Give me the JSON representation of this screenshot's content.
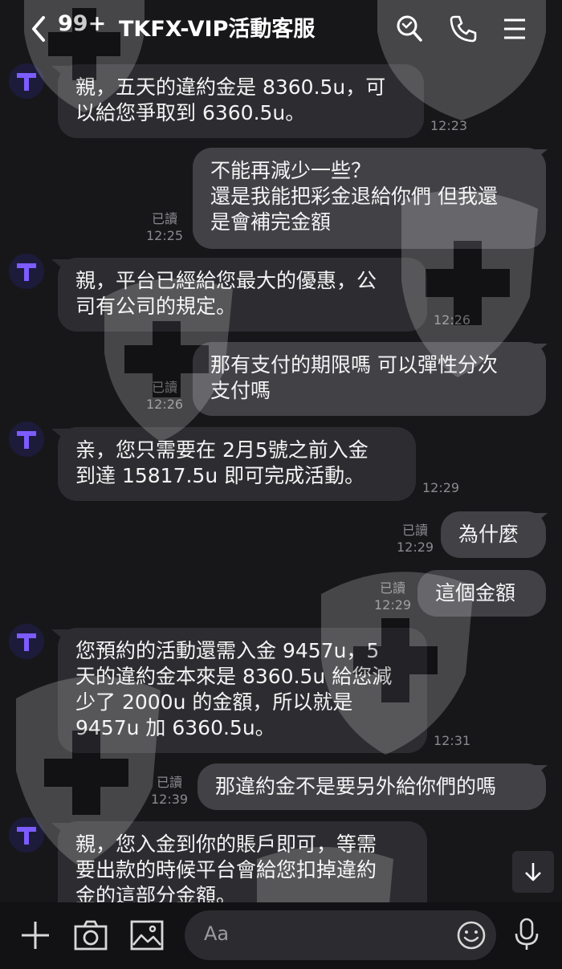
{
  "header": {
    "unread_count": "99+",
    "title": "TKFX-VIP活動客服"
  },
  "messages": [
    {
      "direction": "in",
      "text": "親，五天的違約金是 8360.5u，可\n以給您爭取到 6360.5u。",
      "time": "12:23"
    },
    {
      "direction": "out",
      "text": "不能再減少一些？\n還是我能把彩金退給你們 但我還\n是會補完金額",
      "read_label": "已讀",
      "time": "12:25"
    },
    {
      "direction": "in",
      "text": "親，平台已經給您最大的優惠，公\n司有公司的規定。",
      "time": "12:26"
    },
    {
      "direction": "out",
      "text": "那有支付的期限嗎 可以彈性分次\n支付嗎",
      "read_label": "已讀",
      "time": "12:26"
    },
    {
      "direction": "in",
      "text": "亲，您只需要在 2月5號之前入金\n到達 15817.5u 即可完成活動。",
      "time": "12:29"
    },
    {
      "direction": "out",
      "text": "為什麼",
      "read_label": "已讀",
      "time": "12:29"
    },
    {
      "direction": "out",
      "text": "這個金額",
      "read_label": "已讀",
      "time": "12:29"
    },
    {
      "direction": "in",
      "text": "您預約的活動還需入金 9457u，5\n天的違約金本來是 8360.5u 給您減\n少了 2000u 的金額，所以就是\n9457u 加 6360.5u。",
      "time": "12:31"
    },
    {
      "direction": "out",
      "text": "那違約金不是要另外給你們的嗎",
      "read_label": "已讀",
      "time": "12:39"
    },
    {
      "direction": "in",
      "text": "親，您入金到你的賬戶即可，等需\n要出款的時候平台會給您扣掉違約\n金的這部分金額。",
      "time": ""
    }
  ],
  "input": {
    "placeholder": "Aa"
  },
  "icons": {
    "back": "chevron-left-icon",
    "search": "search-icon",
    "call": "phone-icon",
    "menu": "menu-icon",
    "add": "plus-icon",
    "camera": "camera-icon",
    "gallery": "image-icon",
    "emoji": "emoji-icon",
    "voice": "microphone-icon",
    "scroll": "arrow-down-icon"
  },
  "colors": {
    "background": "#17171a",
    "incoming_bubble": "#2d2d31",
    "outgoing_bubble": "#414146",
    "avatar_accent": "#7c5cff"
  }
}
